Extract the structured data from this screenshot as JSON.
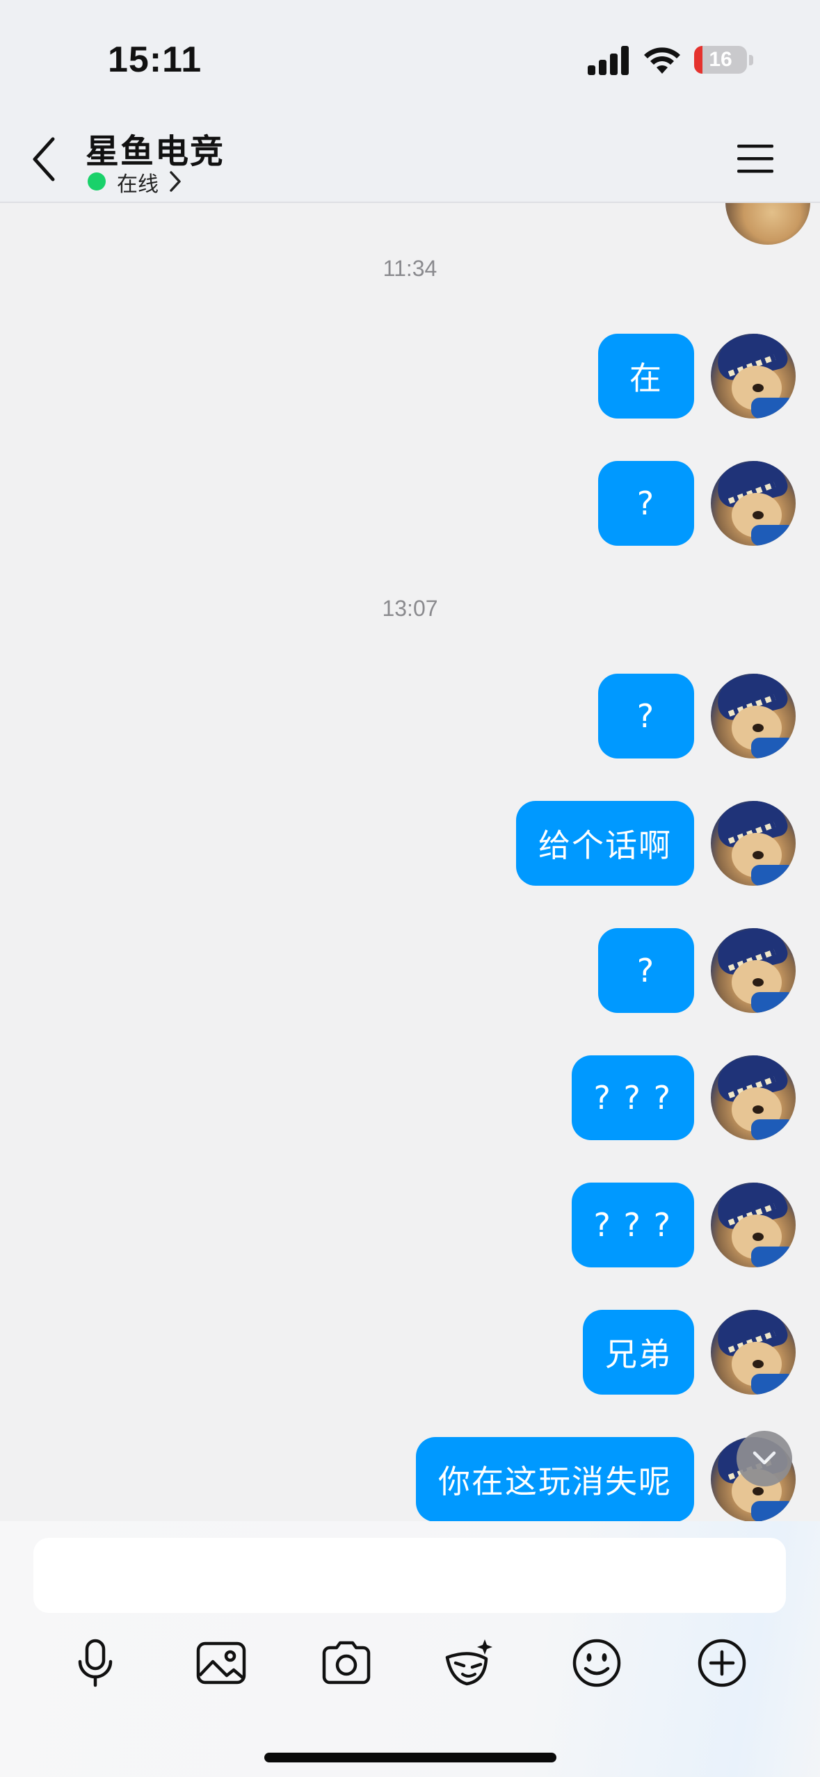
{
  "status_bar": {
    "time": "15:11",
    "battery_level": "16"
  },
  "header": {
    "title": "星鱼电竞",
    "status_text": "在线"
  },
  "timestamps": [
    "11:34",
    "13:07"
  ],
  "messages": [
    {
      "text": "在"
    },
    {
      "text": "?"
    },
    {
      "text": "?"
    },
    {
      "text": "给个话啊"
    },
    {
      "text": "?"
    },
    {
      "text": "? ? ?"
    },
    {
      "text": "? ? ?"
    },
    {
      "text": "兄弟"
    },
    {
      "text": "你在这玩消失呢"
    }
  ],
  "composer": {
    "input_value": "",
    "tools": [
      "microphone-icon",
      "image-icon",
      "camera-icon",
      "sticker-icon",
      "emoji-icon",
      "plus-icon"
    ]
  },
  "colors": {
    "bubble": "#0099ff",
    "online": "#19d16a",
    "background": "#f1f1f2"
  }
}
